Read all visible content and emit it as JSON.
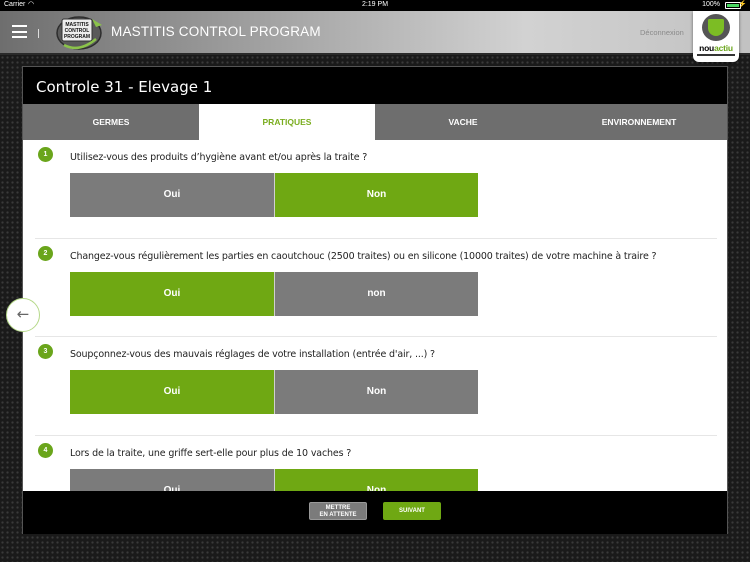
{
  "status_bar": {
    "carrier": "Carrier",
    "wifi_icon": "wifi-icon",
    "time": "2:19 PM",
    "battery_percent": "100%",
    "battery_icon": "battery-icon",
    "charging_icon": "charging-icon"
  },
  "header": {
    "menu_icon": "hamburger-menu-icon",
    "logo_text": "MASTITIS CONTROL PROGRAM",
    "title": "MASTITIS CONTROL PROGRAM",
    "logout_label": "Déconnexion",
    "brand": {
      "name_part1": "nou",
      "name_part2": "actiu"
    }
  },
  "panel": {
    "title": "Controle 31 - Elevage 1",
    "tabs": [
      {
        "label": "GERMES",
        "active": false
      },
      {
        "label": "PRATIQUES",
        "active": true
      },
      {
        "label": "VACHE",
        "active": false
      },
      {
        "label": "ENVIRONNEMENT",
        "active": false
      }
    ],
    "questions": [
      {
        "number": "1",
        "text": "Utilisez-vous des produits d’hygiène avant et/ou après la traite ?",
        "answers": [
          {
            "label": "Oui",
            "selected": false
          },
          {
            "label": "Non",
            "selected": true
          }
        ]
      },
      {
        "number": "2",
        "text": "Changez-vous régulièrement les parties en caoutchouc (2500 traites) ou en silicone (10000 traites) de votre machine à traire ?",
        "answers": [
          {
            "label": "Oui",
            "selected": true
          },
          {
            "label": "non",
            "selected": false
          }
        ]
      },
      {
        "number": "3",
        "text": "Soupçonnez-vous des mauvais réglages de votre installation (entrée d'air, ...) ?",
        "answers": [
          {
            "label": "Oui",
            "selected": true
          },
          {
            "label": "Non",
            "selected": false
          }
        ]
      },
      {
        "number": "4",
        "text": "Lors de la traite, une griffe sert-elle pour plus de 10 vaches ?",
        "answers": [
          {
            "label": "Oui",
            "selected": false
          },
          {
            "label": "Non",
            "selected": true
          }
        ]
      }
    ],
    "footer": {
      "hold_label_line1": "METTRE",
      "hold_label_line2": "EN ATTENTE",
      "next_label": "SUIVANT"
    }
  },
  "back_button": {
    "icon": "arrow-left-icon",
    "glyph": "←"
  },
  "colors": {
    "accent_green": "#6fa813",
    "unselected_gray": "#7b7b7b",
    "tab_active_text": "#7aad1e"
  }
}
